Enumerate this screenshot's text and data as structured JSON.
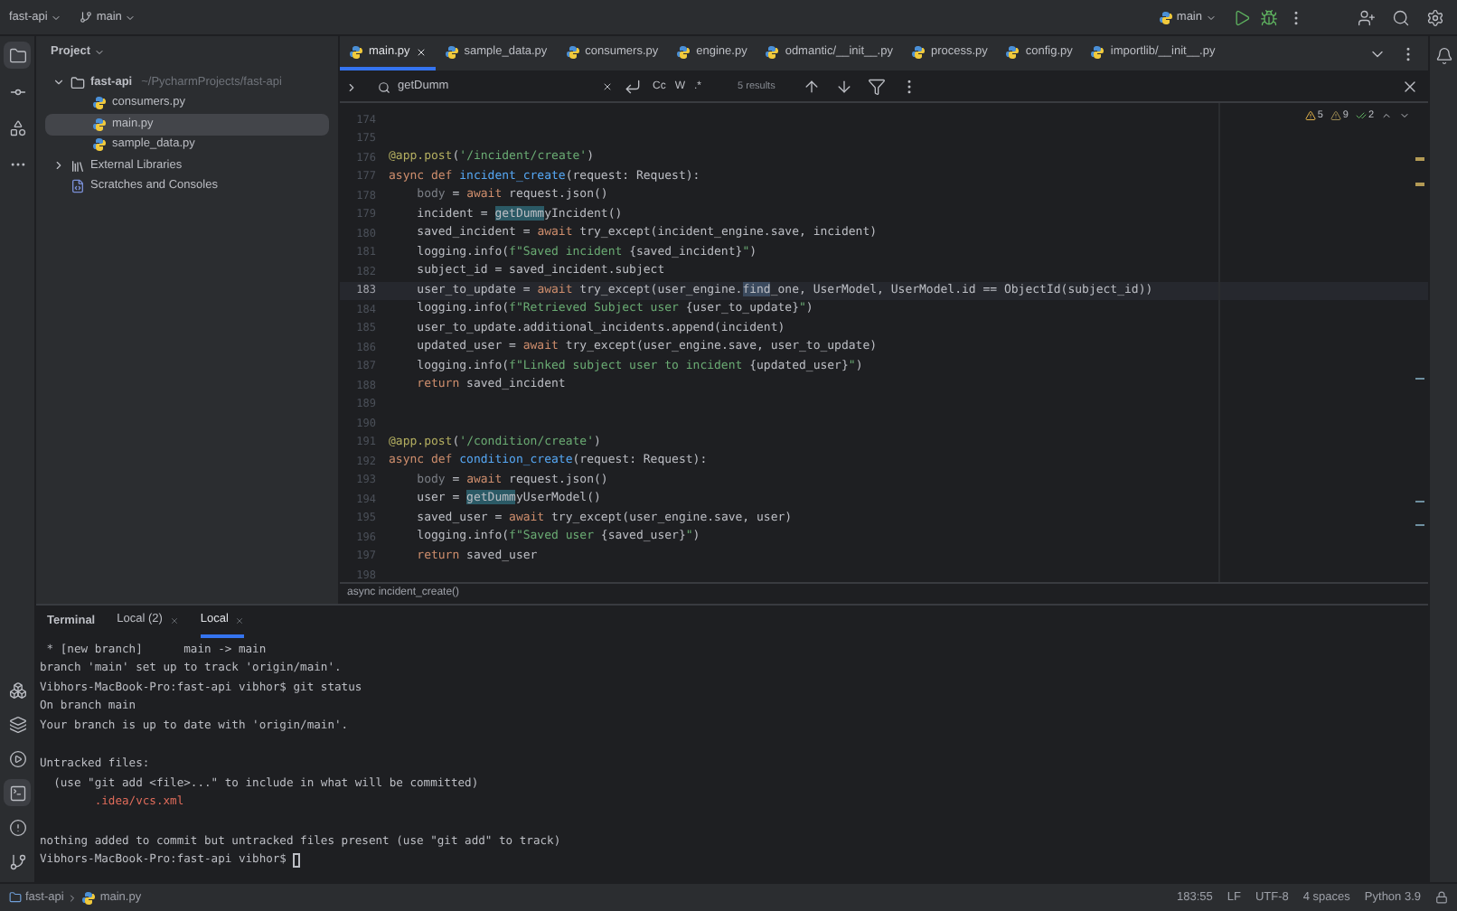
{
  "top_bar": {
    "project": "fast-api",
    "branch": "main",
    "run_config": "main"
  },
  "project_panel": {
    "title": "Project",
    "tree": [
      {
        "label": "fast-api",
        "path": "~/PycharmProjects/fast-api",
        "kind": "folder",
        "expanded": true,
        "selected": false,
        "children": [
          {
            "label": "consumers.py",
            "kind": "python",
            "selected": false
          },
          {
            "label": "main.py",
            "kind": "python",
            "selected": true
          },
          {
            "label": "sample_data.py",
            "kind": "python",
            "selected": false
          }
        ]
      },
      {
        "label": "External Libraries",
        "kind": "library",
        "expanded": false,
        "selected": false
      },
      {
        "label": "Scratches and Consoles",
        "kind": "scratch",
        "selected": false
      }
    ]
  },
  "editor_tabs": [
    {
      "label": "main.py",
      "selected": true
    },
    {
      "label": "sample_data.py",
      "selected": false
    },
    {
      "label": "consumers.py",
      "selected": false
    },
    {
      "label": "engine.py",
      "selected": false
    },
    {
      "label": "odmantic/__init__.py",
      "selected": false
    },
    {
      "label": "process.py",
      "selected": false
    },
    {
      "label": "config.py",
      "selected": false
    },
    {
      "label": "importlib/__init__.py",
      "selected": false
    }
  ],
  "find_bar": {
    "query": "getDumm",
    "options": [
      "Cc",
      "W",
      ".*"
    ],
    "results": "5 results"
  },
  "inspections": [
    {
      "kind": "warning",
      "count": "5"
    },
    {
      "kind": "weak",
      "count": "9"
    },
    {
      "kind": "ok",
      "count": "2"
    }
  ],
  "code": {
    "lines": [
      {
        "number": "174",
        "current": false
      },
      {
        "number": "175",
        "current": false
      },
      {
        "number": "176",
        "current": false,
        "segments": [
          {
            "text": "@app.post",
            "kind": "deco"
          },
          {
            "text": "(",
            "kind": "plain"
          },
          {
            "text": "'/incident/create'",
            "kind": "str"
          },
          {
            "text": ")",
            "kind": "plain"
          }
        ]
      },
      {
        "number": "177",
        "current": false,
        "segments": [
          {
            "text": "async def ",
            "kind": "kw"
          },
          {
            "text": "incident_create",
            "kind": "fn"
          },
          {
            "text": "(request: Request):",
            "kind": "plain"
          }
        ]
      },
      {
        "number": "178",
        "current": false,
        "segments": [
          {
            "text": "    body",
            "kind": "dim"
          },
          {
            "text": " = ",
            "kind": "plain"
          },
          {
            "text": "await",
            "kind": "kw"
          },
          {
            "text": " request.json()",
            "kind": "plain"
          }
        ]
      },
      {
        "number": "179",
        "current": false,
        "segments": [
          {
            "text": "    incident = ",
            "kind": "plain"
          },
          {
            "text": "getDumm",
            "kind": "match"
          },
          {
            "text": "yIncident()",
            "kind": "plain"
          }
        ]
      },
      {
        "number": "180",
        "current": false,
        "segments": [
          {
            "text": "    saved_incident = ",
            "kind": "plain"
          },
          {
            "text": "await",
            "kind": "kw"
          },
          {
            "text": " try_except(incident_engine.save, incident)",
            "kind": "plain"
          }
        ]
      },
      {
        "number": "181",
        "current": false,
        "segments": [
          {
            "text": "    logging.info(",
            "kind": "plain"
          },
          {
            "text": "f\"Saved incident ",
            "kind": "str"
          },
          {
            "text": "{saved_incident}",
            "kind": "plain"
          },
          {
            "text": "\"",
            "kind": "str"
          },
          {
            "text": ")",
            "kind": "plain"
          }
        ]
      },
      {
        "number": "182",
        "current": false,
        "segments": [
          {
            "text": "    subject_id = saved_incident.subject",
            "kind": "plain"
          }
        ]
      },
      {
        "number": "183",
        "current": true,
        "segments": [
          {
            "text": "    user_to_update = ",
            "kind": "plain"
          },
          {
            "text": "await",
            "kind": "kw"
          },
          {
            "text": " try_except(user_engine.",
            "kind": "plain"
          },
          {
            "text": "find",
            "kind": "hl"
          },
          {
            "text": "_one, UserModel, UserModel.id == ObjectId(subject_id))",
            "kind": "plain"
          }
        ]
      },
      {
        "number": "184",
        "current": false,
        "segments": [
          {
            "text": "    logging.info(",
            "kind": "plain"
          },
          {
            "text": "f\"Retrieved Subject user ",
            "kind": "str"
          },
          {
            "text": "{user_to_update}",
            "kind": "plain"
          },
          {
            "text": "\"",
            "kind": "str"
          },
          {
            "text": ")",
            "kind": "plain"
          }
        ]
      },
      {
        "number": "185",
        "current": false,
        "segments": [
          {
            "text": "    user_to_update.additional_incidents.append(incident)",
            "kind": "plain"
          }
        ]
      },
      {
        "number": "186",
        "current": false,
        "segments": [
          {
            "text": "    updated_user = ",
            "kind": "plain"
          },
          {
            "text": "await",
            "kind": "kw"
          },
          {
            "text": " try_except(user_engine.save, user_to_update)",
            "kind": "plain"
          }
        ]
      },
      {
        "number": "187",
        "current": false,
        "segments": [
          {
            "text": "    logging.info(",
            "kind": "plain"
          },
          {
            "text": "f\"Linked subject user to incident ",
            "kind": "str"
          },
          {
            "text": "{updated_user}",
            "kind": "plain"
          },
          {
            "text": "\"",
            "kind": "str"
          },
          {
            "text": ")",
            "kind": "plain"
          }
        ]
      },
      {
        "number": "188",
        "current": false,
        "segments": [
          {
            "text": "    return",
            "kind": "kw"
          },
          {
            "text": " saved_incident",
            "kind": "plain"
          }
        ]
      },
      {
        "number": "189",
        "current": false
      },
      {
        "number": "190",
        "current": false
      },
      {
        "number": "191",
        "current": false,
        "segments": [
          {
            "text": "@app.post",
            "kind": "deco"
          },
          {
            "text": "(",
            "kind": "plain"
          },
          {
            "text": "'/condition/create'",
            "kind": "str"
          },
          {
            "text": ")",
            "kind": "plain"
          }
        ]
      },
      {
        "number": "192",
        "current": false,
        "segments": [
          {
            "text": "async def ",
            "kind": "kw"
          },
          {
            "text": "condition_create",
            "kind": "fn"
          },
          {
            "text": "(request: Request):",
            "kind": "plain"
          }
        ]
      },
      {
        "number": "193",
        "current": false,
        "segments": [
          {
            "text": "    body",
            "kind": "dim"
          },
          {
            "text": " = ",
            "kind": "plain"
          },
          {
            "text": "await",
            "kind": "kw"
          },
          {
            "text": " request.json()",
            "kind": "plain"
          }
        ]
      },
      {
        "number": "194",
        "current": false,
        "segments": [
          {
            "text": "    user = ",
            "kind": "plain"
          },
          {
            "text": "getDumm",
            "kind": "match"
          },
          {
            "text": "yUserModel()",
            "kind": "plain"
          }
        ]
      },
      {
        "number": "195",
        "current": false,
        "segments": [
          {
            "text": "    saved_user = ",
            "kind": "plain"
          },
          {
            "text": "await",
            "kind": "kw"
          },
          {
            "text": " try_except(user_engine.save, user)",
            "kind": "plain"
          }
        ]
      },
      {
        "number": "196",
        "current": false,
        "segments": [
          {
            "text": "    logging.info(",
            "kind": "plain"
          },
          {
            "text": "f\"Saved user ",
            "kind": "str"
          },
          {
            "text": "{saved_user}",
            "kind": "plain"
          },
          {
            "text": "\"",
            "kind": "str"
          },
          {
            "text": ")",
            "kind": "plain"
          }
        ]
      },
      {
        "number": "197",
        "current": false,
        "segments": [
          {
            "text": "    return",
            "kind": "kw"
          },
          {
            "text": " saved_user",
            "kind": "plain"
          }
        ]
      },
      {
        "number": "198",
        "current": false
      }
    ]
  },
  "breadcrumb": "async incident_create()",
  "terminal": {
    "title": "Terminal",
    "tabs": [
      {
        "label": "Local (2)",
        "selected": false
      },
      {
        "label": "Local",
        "selected": true
      }
    ],
    "lines": [
      {
        "kind": "out",
        "text": " * [new branch]      main -> main"
      },
      {
        "kind": "out",
        "text": "branch 'main' set up to track 'origin/main'."
      },
      {
        "kind": "out",
        "text": "Vibhors-MacBook-Pro:fast-api vibhor$ git status"
      },
      {
        "kind": "out",
        "text": "On branch main"
      },
      {
        "kind": "out",
        "text": "Your branch is up to date with 'origin/main'."
      },
      {
        "kind": "blank"
      },
      {
        "kind": "out",
        "text": "Untracked files:"
      },
      {
        "kind": "out",
        "text": "  (use \"git add <file>...\" to include in what will be committed)"
      },
      {
        "kind": "untracked",
        "text": "        .idea/vcs.xml"
      },
      {
        "kind": "blank"
      },
      {
        "kind": "out",
        "text": "nothing added to commit but untracked files present (use \"git add\" to track)"
      },
      {
        "kind": "prompt",
        "text": "Vibhors-MacBook-Pro:fast-api vibhor$ "
      }
    ]
  },
  "status_bar": {
    "path": [
      "fast-api",
      "main.py"
    ],
    "items": [
      "183:55",
      "LF",
      "UTF-8",
      "4 spaces",
      "Python 3.9"
    ]
  }
}
